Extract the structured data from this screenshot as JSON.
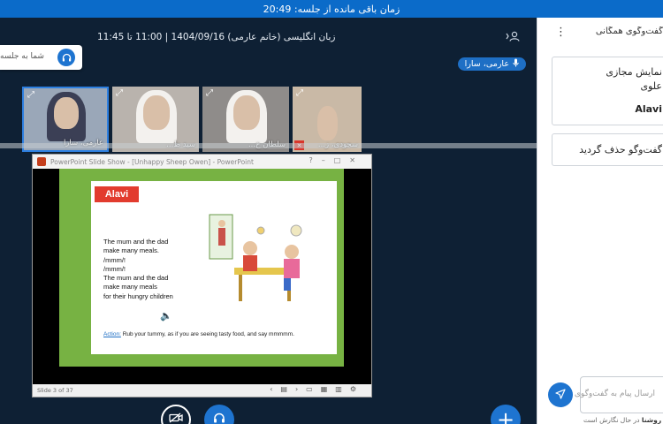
{
  "topbar": {
    "timer_text": "زمان باقی مانده از جلسه: 20:49"
  },
  "header": {
    "session_title": "زبان انگلیسی (خانم عارمی) 1404/09/16 | 11:00 تا 11:45",
    "speaker_name": "عارمی، سارا"
  },
  "toast": {
    "text": "شما به جلسه"
  },
  "tiles": [
    {
      "name": "عارمی، سارا",
      "active": true
    },
    {
      "name": "سید ط...",
      "active": false
    },
    {
      "name": "سلطان خ...",
      "active": false
    },
    {
      "name": "سجودی، ز...",
      "active": false
    }
  ],
  "ppt": {
    "window_title": "PowerPoint Slide Show - [Unhappy Sheep Owen] - PowerPoint",
    "brand": "Alavi",
    "lines": [
      "The mum and the dad",
      "make many meals.",
      "/mmm/!",
      "/mmm/!",
      "The mum and the dad",
      "make many meals",
      "for their hungry children"
    ],
    "activity_label": "Action:",
    "activity_text": "Rub your tummy, as if you are seeing tasty food, and say mmmmm.",
    "status": "Slide 3 of 37"
  },
  "panel": {
    "title": "گفت‌وگوی همگانی",
    "message1": {
      "line1": "نمایش مجازی",
      "line2": "علوی",
      "line3": "Alavi"
    },
    "message2": {
      "line1": "گفت‌وگو حذف گردید"
    },
    "input_placeholder": "ارسال پیام به گفت‌وگوی",
    "typing_name": "روشنا",
    "typing_text": "در حال نگارش است"
  },
  "icons": {
    "user": "user-icon",
    "headset": "headset-icon",
    "mic": "mic-icon",
    "camera_off": "camera-off-icon",
    "plus": "plus-icon",
    "send": "send-icon",
    "more": "more-vertical-icon",
    "expand": "expand-icon"
  },
  "colors": {
    "accent": "#1e74d0",
    "topbar": "#0b6bc9",
    "background": "#0e2034",
    "slide_green": "#77b243",
    "brand_red": "#e23b2e"
  }
}
